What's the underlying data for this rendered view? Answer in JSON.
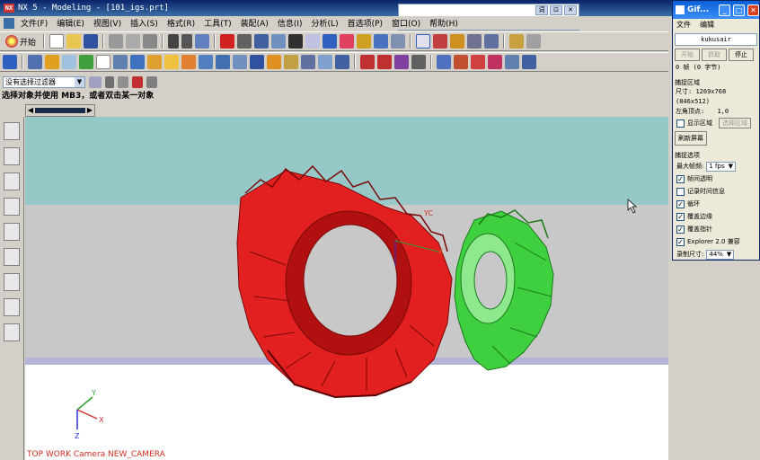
{
  "window": {
    "title": "NX 5 - Modeling - [101_igs.prt]",
    "logo": "NX"
  },
  "menu": {
    "items": [
      "文件(F)",
      "编辑(E)",
      "视图(V)",
      "插入(S)",
      "格式(R)",
      "工具(T)",
      "装配(A)",
      "信息(I)",
      "分析(L)",
      "首选项(P)",
      "窗口(O)",
      "帮助(H)"
    ]
  },
  "toolbar": {
    "start_label": "开始"
  },
  "filter": {
    "value": "没有选择过滤器"
  },
  "cue": {
    "text": "选择对象并使用 MB3，或者双击某一对象"
  },
  "viewport": {
    "wcs_label": "YC",
    "wcs_label2": "X",
    "triad": {
      "x": "X",
      "y": "Y",
      "z": "Z"
    },
    "view_name": "TOP WORK Camera NEW_CAMERA",
    "colors": {
      "gear_red": "#e32020",
      "gear_green": "#3fd03f",
      "bg_top": "#96c8c8",
      "bg_mid": "#c8c8c8",
      "bg_bottom": "#ffffff"
    }
  },
  "popup": {
    "buttons": [
      "词",
      "⊡",
      "✕"
    ]
  },
  "gif_panel": {
    "title": "Gif...",
    "menu": [
      "文件",
      "编辑"
    ],
    "name": "kukusair",
    "buttons": {
      "start": "开始",
      "capture": "抓取",
      "stop": "停止"
    },
    "frames": "0 帧 (0 字节)",
    "capture_area": {
      "section": "捕捉区域",
      "size_label": "尺寸:",
      "size_value": "1269x768  (846x512)",
      "origin_label": "左角顶点:",
      "origin_value": "1,0",
      "show_area": "显示区域",
      "select_area": "选择区域",
      "refresh": "刷新屏幕"
    },
    "options": {
      "section": "捕捉选项",
      "max_fps_label": "最大帧频:",
      "max_fps": "1 fps",
      "frame_transparent": "帧间透明",
      "record_time": "记录时间信息",
      "loop": "循环",
      "cover_border": "覆盖边缘",
      "cover_pointer": "覆盖指针",
      "explorer": "Explorer 2.0 兼容",
      "record_size_label": "录制尺寸:",
      "record_size": "44%"
    },
    "checks": {
      "frame_transparent": true,
      "record_time": false,
      "loop": true,
      "cover_border": true,
      "cover_pointer": true,
      "explorer": true,
      "show_area": false
    }
  }
}
